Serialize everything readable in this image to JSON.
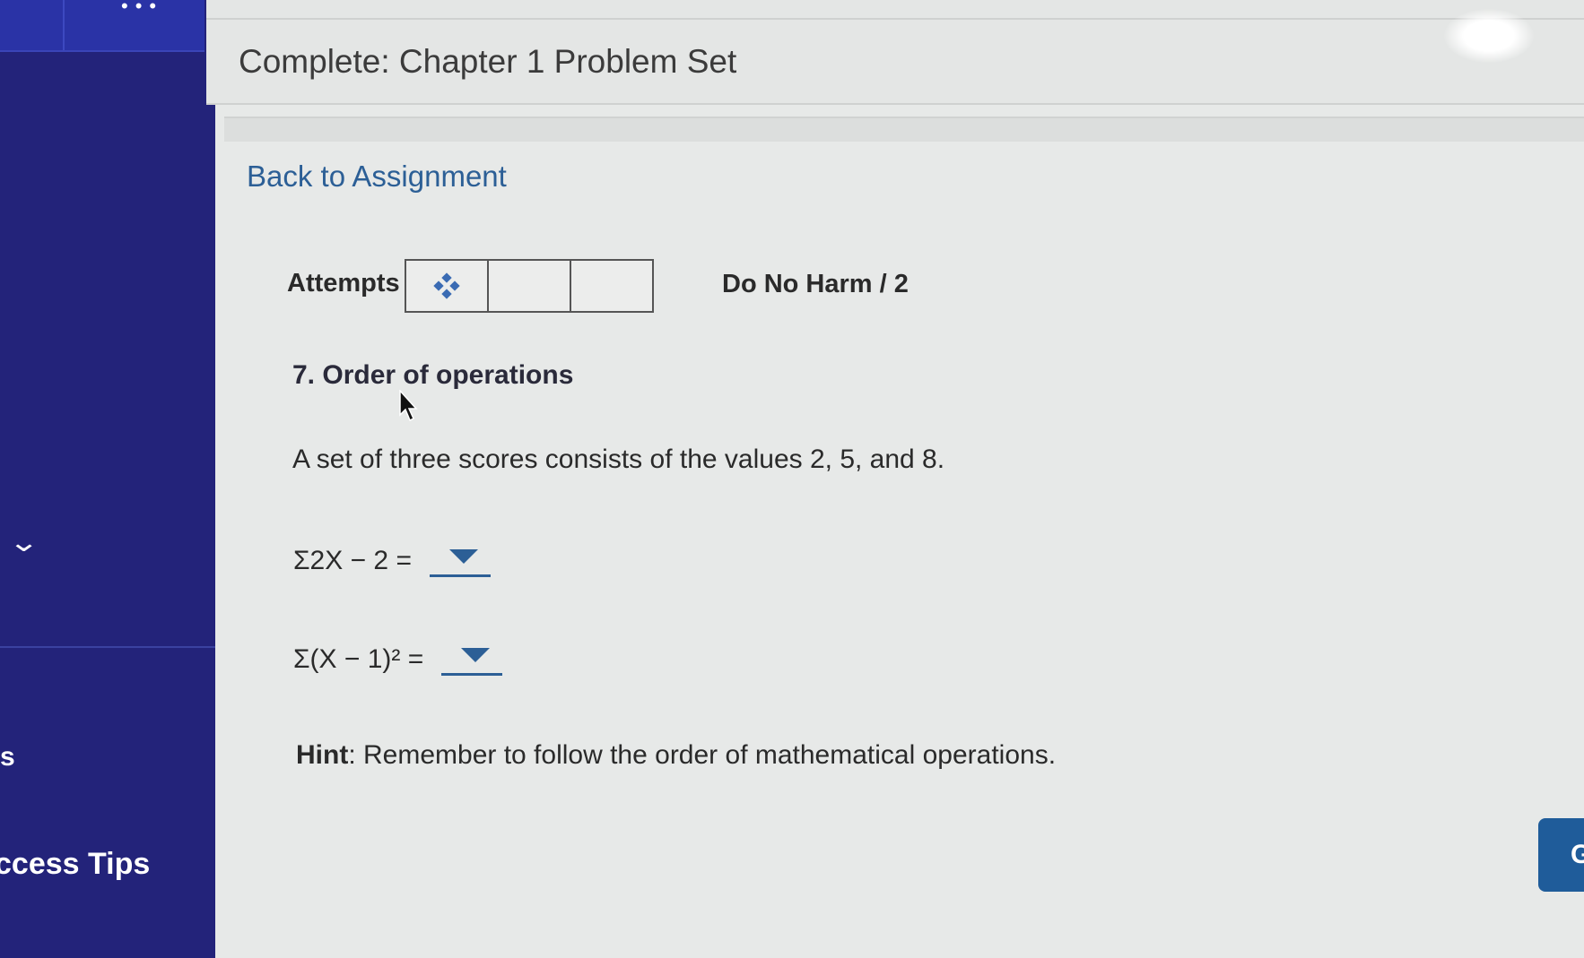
{
  "sidebar": {
    "partial_s": "s",
    "tips_label": "ccess Tips"
  },
  "header": {
    "title": "Complete: Chapter 1 Problem Set"
  },
  "nav": {
    "back_link": "Back to Assignment"
  },
  "attempts": {
    "label": "Attempts",
    "cells": 3
  },
  "score": {
    "label": "Do No Harm / 2"
  },
  "question": {
    "title": "7. Order of operations",
    "text": "A set of three scores consists of the values 2, 5, and 8.",
    "eq1": "Σ2X − 2 =",
    "eq2": "Σ(X − 1)² =",
    "hint_label": "Hint",
    "hint_text": ": Remember to follow the order of mathematical operations."
  },
  "right_button": {
    "label": "G"
  },
  "colors": {
    "sidebar": "#23237a",
    "accent": "#2c5f96"
  },
  "icons": [
    "move-icon",
    "chevron-down-icon",
    "pointer-cursor-icon",
    "dropdown-arrow-icon"
  ]
}
